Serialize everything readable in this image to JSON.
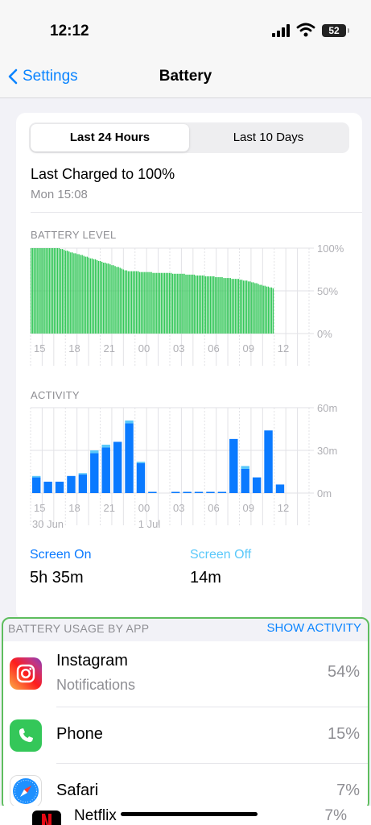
{
  "status_bar": {
    "time": "12:12",
    "battery": "52"
  },
  "nav": {
    "back_label": "Settings",
    "title": "Battery"
  },
  "segments": [
    "Last 24 Hours",
    "Last 10 Days"
  ],
  "last_charged": {
    "title": "Last Charged to 100%",
    "time": "Mon 15:08"
  },
  "battery_level": {
    "label": "BATTERY LEVEL",
    "y_ticks": [
      "100%",
      "50%",
      "0%"
    ],
    "x_ticks": [
      "15",
      "18",
      "21",
      "00",
      "03",
      "06",
      "09",
      "12"
    ]
  },
  "activity": {
    "label": "ACTIVITY",
    "y_ticks": [
      "60m",
      "30m",
      "0m"
    ],
    "x_ticks": [
      "15",
      "18",
      "21",
      "00",
      "03",
      "06",
      "09",
      "12"
    ],
    "date_labels": [
      "30 Jun",
      "1 Jul"
    ]
  },
  "screen_stats": {
    "on_label": "Screen On",
    "on_value": "5h 35m",
    "off_label": "Screen Off",
    "off_value": "14m"
  },
  "usage": {
    "title": "BATTERY USAGE BY APP",
    "show_activity": "SHOW ACTIVITY",
    "apps": [
      {
        "name": "Instagram",
        "detail": "Notifications",
        "percent": "54%",
        "icon": "instagram-icon"
      },
      {
        "name": "Phone",
        "detail": "",
        "percent": "15%",
        "icon": "phone-icon"
      },
      {
        "name": "Safari",
        "detail": "",
        "percent": "7%",
        "icon": "safari-icon"
      },
      {
        "name": "Netflix",
        "detail": "",
        "percent": "7%",
        "icon": "netflix-icon"
      }
    ]
  },
  "colors": {
    "accent": "#0a84ff",
    "battery_green": "#34c759",
    "screen_on": "#0a7aff",
    "screen_off": "#5ac8fa",
    "highlight": "#5ebd5e"
  },
  "chart_data": [
    {
      "type": "bar",
      "title": "BATTERY LEVEL",
      "x_ticks": [
        "15",
        "18",
        "21",
        "00",
        "03",
        "06",
        "09",
        "12"
      ],
      "y_ticks": [
        "100%",
        "50%",
        "0%"
      ],
      "ylim": [
        0,
        100
      ],
      "values": [
        100,
        100,
        100,
        100,
        100,
        100,
        100,
        100,
        100,
        100,
        100,
        100,
        100,
        100,
        100,
        100,
        100,
        100,
        99,
        99,
        98,
        97,
        97,
        96,
        95,
        95,
        94,
        94,
        93,
        93,
        92,
        92,
        91,
        90,
        90,
        89,
        88,
        88,
        87,
        87,
        86,
        85,
        85,
        84,
        83,
        83,
        82,
        82,
        81,
        80,
        80,
        79,
        78,
        78,
        77,
        76,
        75,
        74,
        74,
        73,
        73,
        73,
        73,
        73,
        73,
        73,
        72,
        72,
        72,
        72,
        72,
        72,
        72,
        72,
        71,
        71,
        71,
        71,
        71,
        71,
        71,
        71,
        71,
        71,
        71,
        71,
        70,
        70,
        70,
        70,
        70,
        70,
        70,
        70,
        69,
        69,
        69,
        69,
        69,
        69,
        68,
        68,
        68,
        68,
        68,
        68,
        67,
        67,
        67,
        67,
        67,
        67,
        66,
        66,
        66,
        66,
        66,
        65,
        65,
        65,
        65,
        65,
        64,
        64,
        64,
        64,
        64,
        63,
        63,
        62,
        62,
        62,
        61,
        61,
        60,
        60,
        59,
        59,
        58,
        57,
        57,
        56,
        56,
        55,
        55,
        54,
        54,
        53
      ]
    },
    {
      "type": "bar",
      "title": "ACTIVITY",
      "x_ticks": [
        "15",
        "18",
        "21",
        "00",
        "03",
        "06",
        "09",
        "12"
      ],
      "y_ticks": [
        "60m",
        "30m",
        "0m"
      ],
      "ylim": [
        0,
        60
      ],
      "series": [
        {
          "name": "Screen On",
          "values": [
            11,
            8,
            8,
            12,
            13,
            28,
            32,
            36,
            49,
            21,
            0.5,
            0,
            0.5,
            0.5,
            0.5,
            0.5,
            0.5,
            38,
            17,
            11,
            44,
            6
          ]
        },
        {
          "name": "Screen Off",
          "values": [
            1,
            0,
            0,
            0,
            1,
            2,
            2,
            0,
            2,
            1,
            0,
            0,
            0,
            0,
            0,
            0,
            0,
            0,
            2,
            0,
            0,
            0
          ]
        }
      ]
    }
  ]
}
